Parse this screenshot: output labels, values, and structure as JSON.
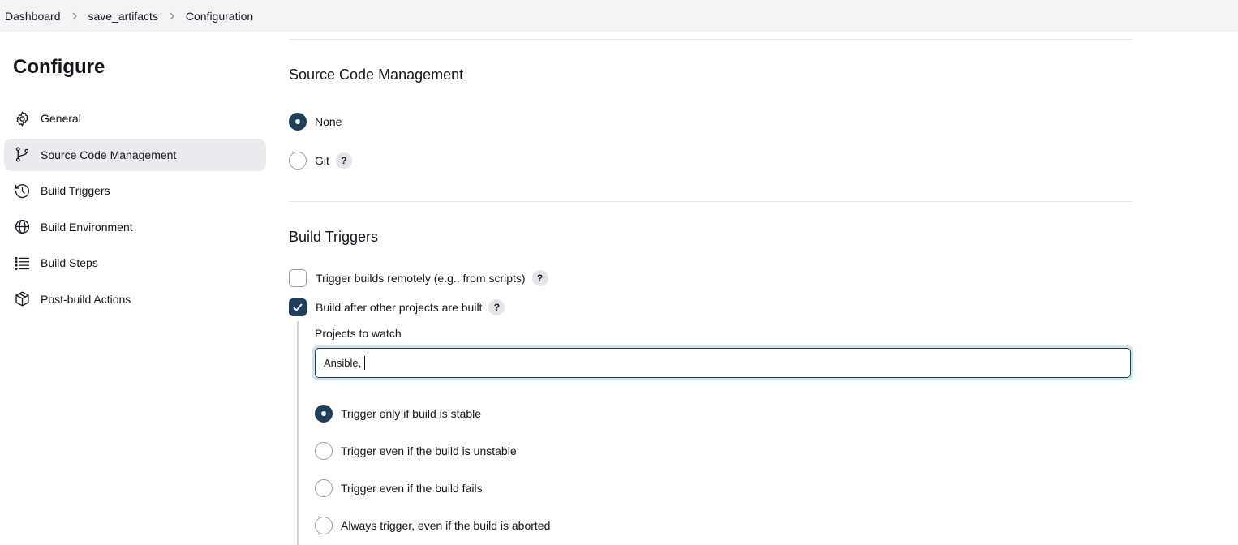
{
  "breadcrumb": [
    {
      "label": "Dashboard"
    },
    {
      "label": "save_artifacts"
    },
    {
      "label": "Configuration"
    }
  ],
  "sidebar": {
    "title": "Configure",
    "items": [
      {
        "label": "General",
        "icon": "gear-icon"
      },
      {
        "label": "Source Code Management",
        "icon": "branch-icon",
        "active": true
      },
      {
        "label": "Build Triggers",
        "icon": "clock-icon"
      },
      {
        "label": "Build Environment",
        "icon": "globe-icon"
      },
      {
        "label": "Build Steps",
        "icon": "list-icon"
      },
      {
        "label": "Post-build Actions",
        "icon": "package-icon"
      }
    ]
  },
  "scm": {
    "title": "Source Code Management",
    "options": [
      {
        "label": "None",
        "checked": true
      },
      {
        "label": "Git",
        "checked": false,
        "help": "?"
      }
    ]
  },
  "triggers": {
    "title": "Build Triggers",
    "remote": {
      "label": "Trigger builds remotely (e.g., from scripts)",
      "checked": false,
      "help": "?"
    },
    "after_other": {
      "label": "Build after other projects are built",
      "checked": true,
      "help": "?"
    },
    "projects_label": "Projects to watch",
    "projects_value": "Ansible,",
    "conditions": [
      {
        "label": "Trigger only if build is stable",
        "checked": true
      },
      {
        "label": "Trigger even if the build is unstable",
        "checked": false
      },
      {
        "label": "Trigger even if the build fails",
        "checked": false
      },
      {
        "label": "Always trigger, even if the build is aborted",
        "checked": false
      }
    ]
  },
  "colors": {
    "accent": "#1d3f5c",
    "focus_ring": "#cfe3ee",
    "active_nav": "#ebebef"
  }
}
